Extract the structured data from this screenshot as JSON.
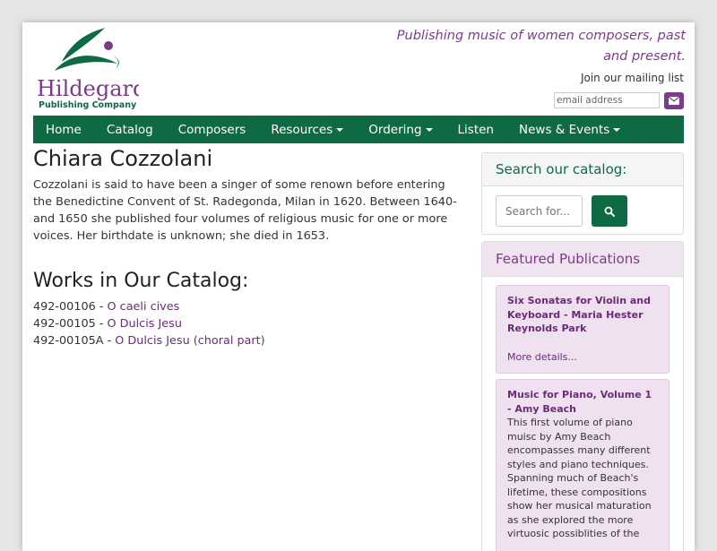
{
  "header": {
    "logo_name": "Hildegard",
    "logo_sub": "Publishing Company",
    "tagline": "Publishing music of women composers, past and present.",
    "mailing_label": "Join our mailing list",
    "email_placeholder": "email address"
  },
  "nav": {
    "items": [
      {
        "label": "Home",
        "dropdown": false
      },
      {
        "label": "Catalog",
        "dropdown": false
      },
      {
        "label": "Composers",
        "dropdown": false
      },
      {
        "label": "Resources",
        "dropdown": true
      },
      {
        "label": "Ordering",
        "dropdown": true
      },
      {
        "label": "Listen",
        "dropdown": false
      },
      {
        "label": "News & Events",
        "dropdown": true
      }
    ]
  },
  "main": {
    "title": "Chiara Cozzolani",
    "bio": "Cozzolani is said to have been a singer of some renown before entering the Benedictine Convent of St. Radegonda, Milan in 1620. Between 1640- and 1650 she published four volumes of religious music for one or more voices. Her birthdate is unknown; she died in 1653.",
    "works_title": "Works in Our Catalog:",
    "works": [
      {
        "code": "492-00106 - ",
        "title": "O caeli cives"
      },
      {
        "code": "492-00105 - ",
        "title": "O Dulcis Jesu"
      },
      {
        "code": "492-00105A - ",
        "title": "O Dulcis Jesu (choral part)"
      }
    ]
  },
  "sidebar": {
    "search_title": "Search our catalog:",
    "search_placeholder": "Search for...",
    "featured_title": "Featured Publications",
    "publications": [
      {
        "title": "Six Sonatas for Violin and Keyboard - Maria Hester Reynolds Park",
        "link": "More details..."
      },
      {
        "title": "Music for Piano, Volume 1 - Amy Beach",
        "description": "This first volume of piano muisc by Amy Beach encompasses many different styles and piano techniques. Spanning much of Beach's lifetime, these compositions show her musical maturation as she explored the more virtuosic possiblities of the"
      }
    ]
  },
  "colors": {
    "brand_green": "#0e6a43",
    "brand_purple": "#7d3a8c"
  }
}
